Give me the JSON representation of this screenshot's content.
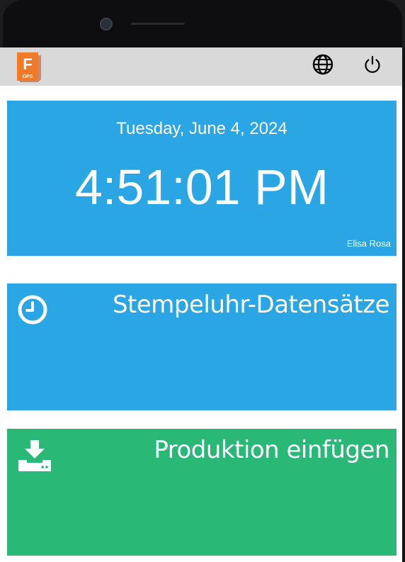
{
  "header": {
    "logo_letter": "F",
    "logo_caption": "OPS"
  },
  "clock": {
    "date": "Tuesday, June 4, 2024",
    "time": "4:51:01 PM",
    "user": "Elisa Rosa"
  },
  "tiles": [
    {
      "label": "Stempeluhr-Datensätze",
      "icon": "clock-icon",
      "color": "#29a6e3"
    },
    {
      "label": "Produktion einfügen",
      "icon": "download-tray-icon",
      "color": "#2ab877"
    }
  ],
  "colors": {
    "topbar": "#d9d9d9",
    "accent_blue": "#29a6e3",
    "accent_green": "#2ab877",
    "logo_orange": "#e8641c"
  }
}
